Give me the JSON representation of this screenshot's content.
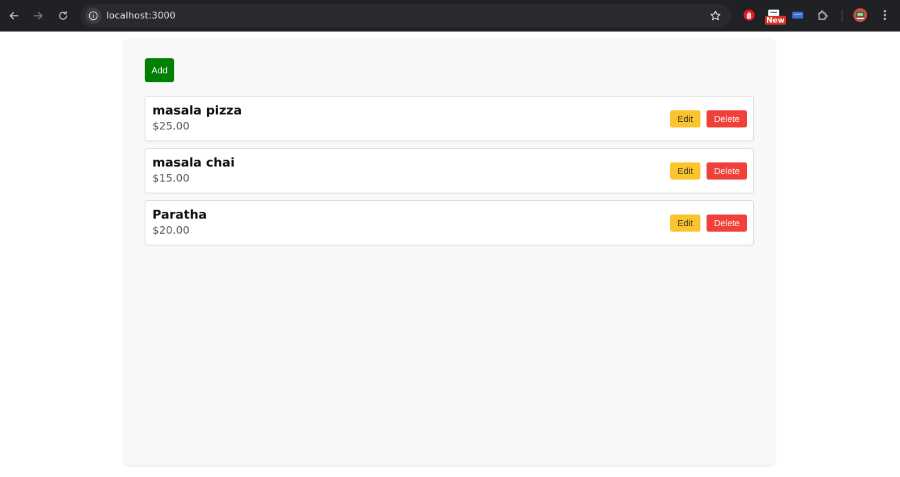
{
  "browser": {
    "url": "localhost:3000",
    "extension_badge": "New",
    "icons": [
      "back-icon",
      "forward-icon",
      "reload-icon",
      "site-info-icon",
      "bookmark-star-icon",
      "extension-red-hand-icon",
      "extension-news-icon",
      "extension-blue-icon",
      "extensions-puzzle-icon",
      "profile-avatar-icon",
      "more-menu-icon"
    ]
  },
  "toolbar": {
    "add_label": "Add"
  },
  "items": [
    {
      "name": "masala pizza",
      "price": "$25.00",
      "edit_label": "Edit",
      "delete_label": "Delete"
    },
    {
      "name": "masala chai",
      "price": "$15.00",
      "edit_label": "Edit",
      "delete_label": "Delete"
    },
    {
      "name": "Paratha",
      "price": "$20.00",
      "edit_label": "Edit",
      "delete_label": "Delete"
    }
  ],
  "colors": {
    "add": "#008000",
    "edit": "#fbc32c",
    "delete": "#f0403a",
    "container": "#f8f8f8",
    "chrome": "#202124"
  }
}
